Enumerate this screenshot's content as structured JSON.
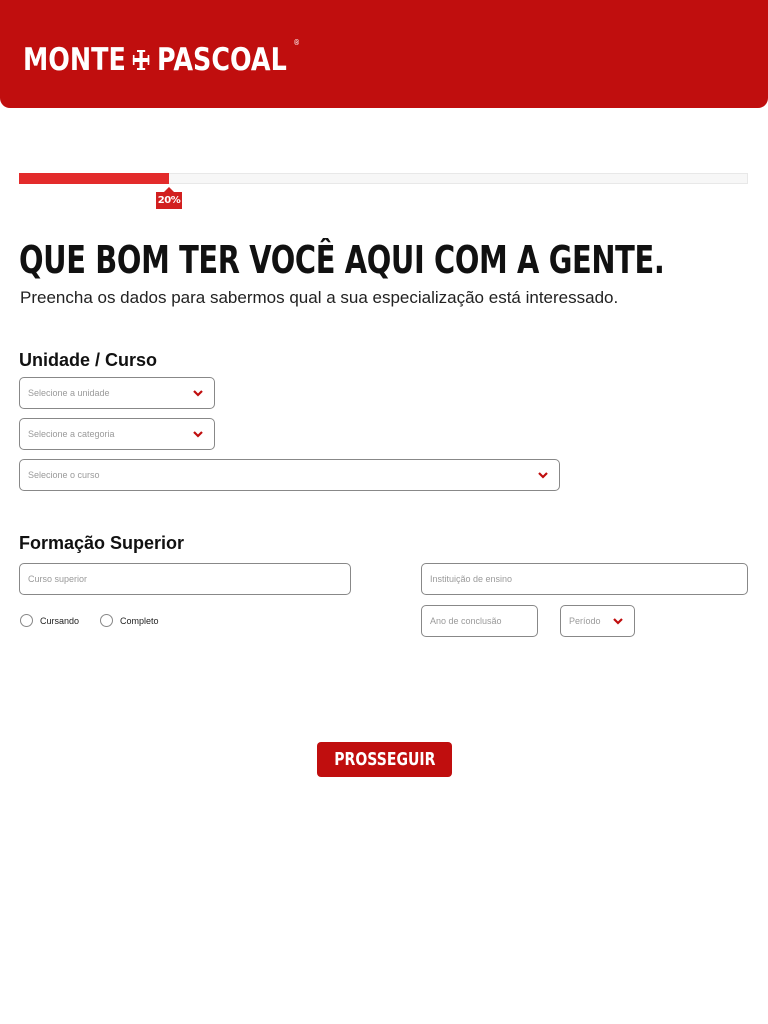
{
  "brand": {
    "name_left": "MONTE",
    "name_right": "PASCOAL",
    "registered_mark": "®",
    "color": "#c00e0e"
  },
  "progress": {
    "value": 0.2,
    "label": "20%",
    "fill_color": "#e32b2b"
  },
  "heading": {
    "title": "QUE BOM TER VOCÊ AQUI COM A GENTE.",
    "subtitle": "Preencha os dados para sabermos qual a sua especialização está interessado."
  },
  "unidade_curso": {
    "heading": "Unidade / Curso",
    "unidade_placeholder": "Selecione a unidade",
    "categoria_placeholder": "Selecione a categoria",
    "curso_placeholder": "Selecione o curso"
  },
  "formacao": {
    "heading": "Formação Superior",
    "curso_superior_placeholder": "Curso superior",
    "instituicao_placeholder": "Instituição de ensino",
    "ano_conclusao_placeholder": "Ano de conclusão",
    "periodo_placeholder": "Período",
    "status_options": [
      "Cursando",
      "Completo"
    ]
  },
  "actions": {
    "submit_label": "PROSSEGUIR"
  },
  "icons": {
    "select_arrow": "chevron-down-icon",
    "logo_mark": "cross-icon"
  }
}
